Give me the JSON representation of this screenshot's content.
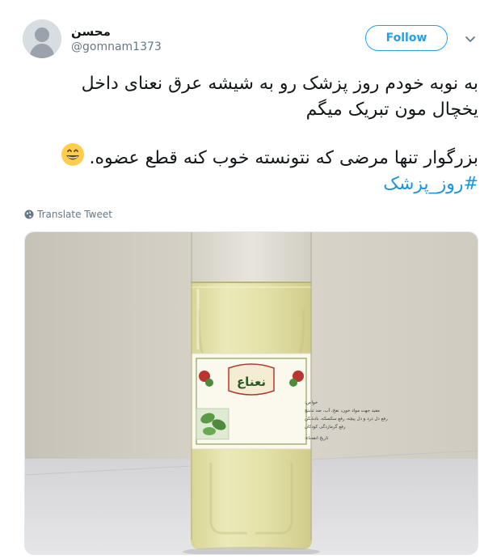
{
  "user": {
    "display_name": "محسن",
    "handle": "@gomnam1373"
  },
  "follow_label": "Follow",
  "tweet": {
    "line1": "به نوبه خودم روز پزشک رو به شیشه عرق نعنای داخل",
    "line2": "یخچال مون تبریک میگم",
    "line3": "بزرگوار تنها مرضی که نتونسته خوب کنه قطع عضوه.",
    "hashtag": "#روز_پزشک"
  },
  "translate_label": "Translate Tweet",
  "media": {
    "label_title": "نعناع",
    "label_lines": [
      "خواص:",
      "مفید جهت مواد خون، نفخ، آب، ضد تشنج",
      "رفع دل درد و دل پیچه، رفع سکسکه، بادشکن",
      "رفع گرمازدگی کودکان",
      "تاریخ انقضاء:"
    ]
  },
  "icons": {
    "caret": "chevron-down-icon",
    "globe": "globe-icon",
    "emoji": "grinning-face-icon",
    "avatar": "default-avatar"
  },
  "colors": {
    "accent": "#1da1f2",
    "hashtag": "#1b95e0",
    "muted": "#657786"
  }
}
